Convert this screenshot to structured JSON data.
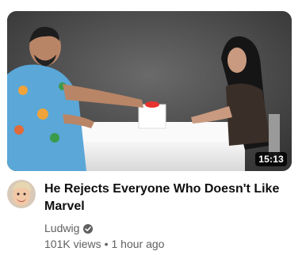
{
  "video": {
    "title": "He Rejects Everyone Who Doesn't Like Marvel",
    "duration": "15:13",
    "channel": "Ludwig",
    "views": "101K views",
    "separator": "•",
    "age": "1 hour ago"
  },
  "icons": {
    "verified": "verified-check-icon",
    "avatar": "channel-avatar"
  },
  "colors": {
    "title": "#0f0f0f",
    "secondary_text": "#606060",
    "button_red": "#e8322f",
    "thumb_bg": "#4a4a4a"
  }
}
